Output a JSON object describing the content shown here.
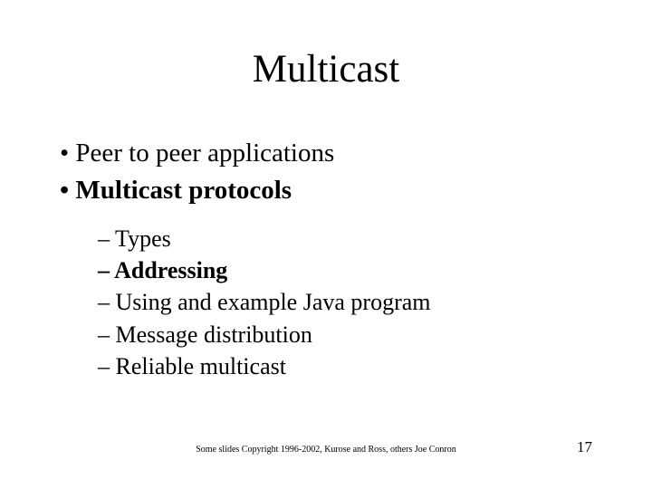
{
  "title": "Multicast",
  "bullets": {
    "b1": "Peer to peer applications",
    "b2": "Multicast protocols",
    "s1": "Types",
    "s2": "Addressing",
    "s3": "Using and example Java program",
    "s4": "Message distribution",
    "s5": "Reliable multicast"
  },
  "footer": "Some slides Copyright 1996-2002, Kurose and Ross, others Joe Conron",
  "page_number": "17"
}
